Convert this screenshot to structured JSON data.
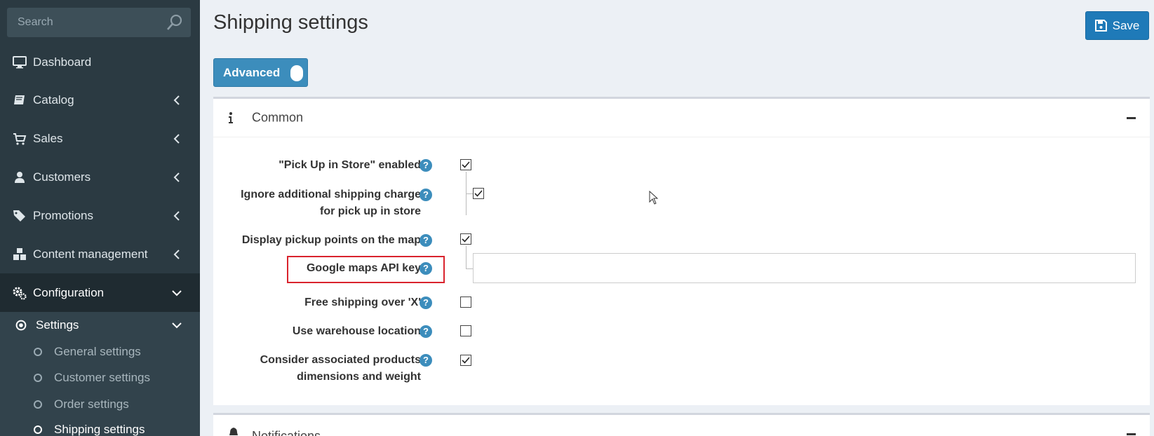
{
  "sidebar": {
    "search_placeholder": "Search",
    "items": [
      {
        "label": "Dashboard",
        "icon": "monitor-icon"
      },
      {
        "label": "Catalog",
        "icon": "book-icon"
      },
      {
        "label": "Sales",
        "icon": "cart-icon"
      },
      {
        "label": "Customers",
        "icon": "user-icon"
      },
      {
        "label": "Promotions",
        "icon": "tags-icon"
      },
      {
        "label": "Content management",
        "icon": "cubes-icon"
      },
      {
        "label": "Configuration",
        "icon": "gears-icon"
      }
    ],
    "settings": {
      "label": "Settings",
      "children": [
        {
          "label": "General settings"
        },
        {
          "label": "Customer settings"
        },
        {
          "label": "Order settings"
        },
        {
          "label": "Shipping settings"
        }
      ]
    }
  },
  "header": {
    "title": "Shipping settings",
    "save_label": "Save",
    "advanced_label": "Advanced"
  },
  "common_card": {
    "title": "Common",
    "fields": [
      {
        "label": "\"Pick Up in Store\" enabled",
        "checked": true
      },
      {
        "label_line1": "Ignore additional shipping charge",
        "label_line2": "for pick up in store",
        "checked": true
      },
      {
        "label": "Display pickup points on the map",
        "checked": true
      },
      {
        "label": "Google maps API key",
        "value": ""
      },
      {
        "label": "Free shipping over 'X'",
        "checked": false
      },
      {
        "label": "Use warehouse location",
        "checked": false
      },
      {
        "label_line1": "Consider associated products",
        "label_line2": "dimensions and weight",
        "checked": true
      }
    ],
    "help_symbol": "?"
  },
  "notifications_card": {
    "title": "Notifications"
  },
  "colors": {
    "sidebar_bg": "#2b3a42",
    "primary": "#3c8dbc",
    "save_button": "#1f7ab8",
    "highlight": "#d9232d"
  }
}
